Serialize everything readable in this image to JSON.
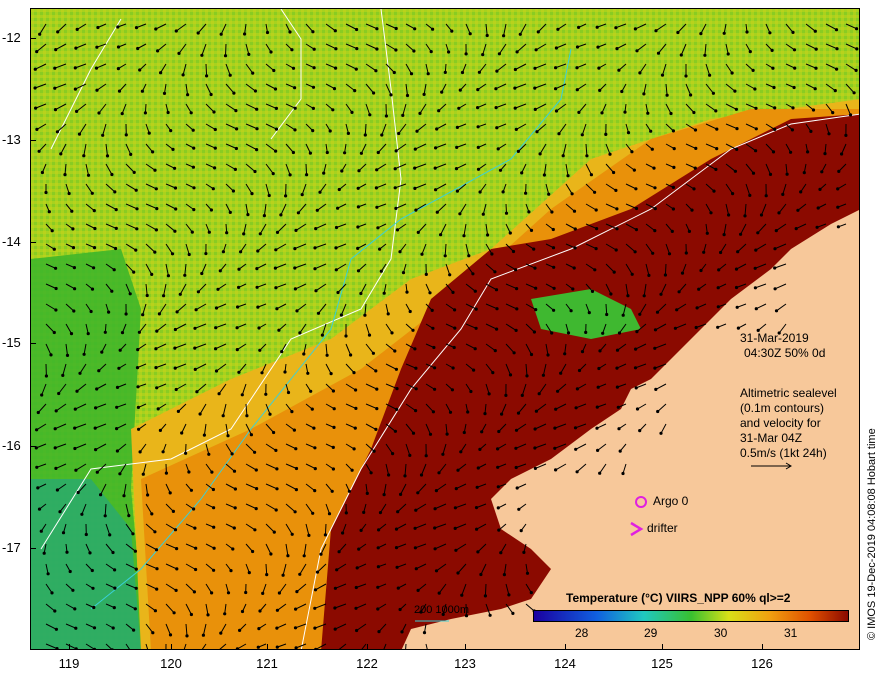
{
  "map": {
    "y_ticks": [
      "-12",
      "-13",
      "-14",
      "-15",
      "-16",
      "-17"
    ],
    "x_ticks": [
      "119",
      "120",
      "121",
      "122",
      "123",
      "124",
      "125",
      "126"
    ],
    "info": {
      "date": "31-Mar-2019",
      "time": "04:30Z  50% 0d"
    },
    "sealevel_text": [
      "Altimetric sealevel",
      "(0.1m contours)",
      "and velocity for",
      "31-Mar 04Z",
      "0.5m/s (1kt 24h)"
    ],
    "legend": {
      "title": "Temperature (°C) VIIRS_NPP 60% ql>=2",
      "ticks": [
        "28",
        "29",
        "30",
        "31"
      ]
    },
    "argo_label": "Argo 0",
    "drifter_label": "drifter",
    "depth_label": "200  1000m",
    "credit": "© IMOS 19-Dec-2019 04:08:08 Hobart time",
    "colors": {
      "land": "#f7c89a",
      "warm": "#8b0a00",
      "orange": "#e9910a",
      "yellow": "#e6d21a",
      "green": "#35b52c",
      "marker": "#e020e0",
      "contour": "#ffffff",
      "isobath": "#3ad0d8"
    }
  }
}
